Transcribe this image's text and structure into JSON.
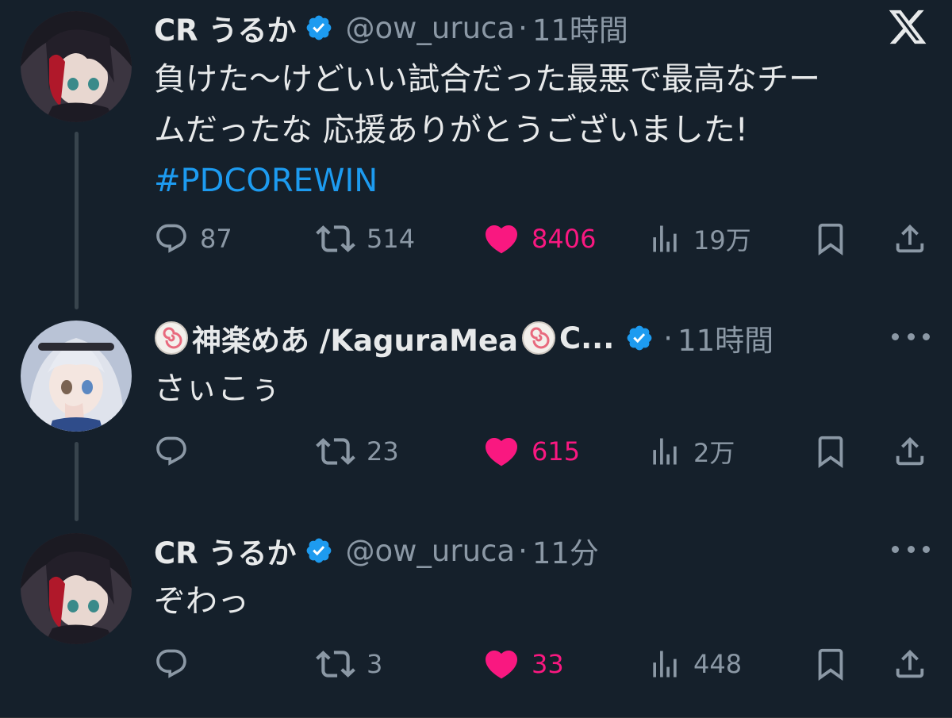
{
  "colors": {
    "background": "#15202b",
    "text": "#e7e9ea",
    "muted": "#8b98a5",
    "link": "#1d9bf0",
    "like": "#f91880",
    "verified": "#1d9bf0"
  },
  "posts": [
    {
      "name": "CR うるか",
      "handle": "@ow_uruca",
      "separator": "·",
      "time": "11時間",
      "text_lines": [
        "負けた〜けどいい試合だった最悪で最高なチー",
        "ムだったな 応援ありがとうございました!"
      ],
      "hashtag": "#PDCOREWIN",
      "stats": {
        "replies": "87",
        "reposts": "514",
        "likes": "8406",
        "views": "19万"
      }
    },
    {
      "name": "神楽めあ /KaguraMea",
      "name_suffix": "C...",
      "separator": "·",
      "time": "11時間",
      "text_lines": [
        "さぃこぅ"
      ],
      "stats": {
        "replies": "",
        "reposts": "23",
        "likes": "615",
        "views": "2万"
      }
    },
    {
      "name": "CR うるか",
      "handle": "@ow_uruca",
      "separator": "·",
      "time": "11分",
      "text_lines": [
        "ぞわっ"
      ],
      "stats": {
        "replies": "",
        "reposts": "3",
        "likes": "33",
        "views": "448"
      }
    }
  ],
  "icons": [
    "x-logo-icon",
    "verified-badge-icon",
    "reply-icon",
    "repost-icon",
    "heart-icon",
    "views-icon",
    "bookmark-icon",
    "share-icon",
    "more-icon",
    "naruto-emoji-icon"
  ]
}
